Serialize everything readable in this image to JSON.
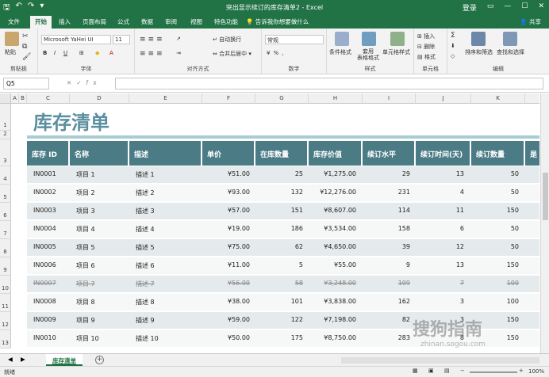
{
  "window": {
    "title": "突出显示续订的库存清单2 - Excel",
    "login": "登录"
  },
  "tabs": [
    "文件",
    "开始",
    "插入",
    "页面布局",
    "公式",
    "数据",
    "审阅",
    "视图",
    "特色功能"
  ],
  "tell_me": "告诉我你想要做什么",
  "share": "共享",
  "ribbon": {
    "paste": "粘贴",
    "clipboard": "剪贴板",
    "font_name": "Microsoft YaHei UI",
    "font_size": "11",
    "font_group": "字体",
    "wrap": "自动换行",
    "merge": "合并后居中",
    "align_group": "对齐方式",
    "num_format": "常规",
    "number_group": "数字",
    "cond_format": "条件格式",
    "table_format": "套用\n表格格式",
    "cell_style": "单元格样式",
    "styles_group": "样式",
    "insert": "插入",
    "delete": "删除",
    "format": "格式",
    "cells_group": "单元格",
    "sort": "排序和筛选",
    "find": "查找和选择",
    "edit_group": "编辑"
  },
  "namebox": "Q5",
  "columns": [
    "A",
    "B",
    "C",
    "D",
    "E",
    "F",
    "G",
    "H",
    "I",
    "J",
    "K"
  ],
  "sheet": {
    "title": "库存清单",
    "headers": [
      "库存 ID",
      "名称",
      "描述",
      "单价",
      "在库数量",
      "库存价值",
      "续订水平",
      "续订时间(天)",
      "续订数量",
      "是"
    ],
    "rows": [
      {
        "id": "IN0001",
        "name": "项目 1",
        "desc": "描述 1",
        "price": "¥51.00",
        "qty": "25",
        "value": "¥1,275.00",
        "level": "29",
        "days": "13",
        "reorder": "50"
      },
      {
        "id": "IN0002",
        "name": "项目 2",
        "desc": "描述 2",
        "price": "¥93.00",
        "qty": "132",
        "value": "¥12,276.00",
        "level": "231",
        "days": "4",
        "reorder": "50"
      },
      {
        "id": "IN0003",
        "name": "项目 3",
        "desc": "描述 3",
        "price": "¥57.00",
        "qty": "151",
        "value": "¥8,607.00",
        "level": "114",
        "days": "11",
        "reorder": "150"
      },
      {
        "id": "IN0004",
        "name": "项目 4",
        "desc": "描述 4",
        "price": "¥19.00",
        "qty": "186",
        "value": "¥3,534.00",
        "level": "158",
        "days": "6",
        "reorder": "50"
      },
      {
        "id": "IN0005",
        "name": "项目 5",
        "desc": "描述 5",
        "price": "¥75.00",
        "qty": "62",
        "value": "¥4,650.00",
        "level": "39",
        "days": "12",
        "reorder": "50"
      },
      {
        "id": "IN0006",
        "name": "项目 6",
        "desc": "描述 6",
        "price": "¥11.00",
        "qty": "5",
        "value": "¥55.00",
        "level": "9",
        "days": "13",
        "reorder": "150"
      },
      {
        "id": "IN0007",
        "name": "项目 7",
        "desc": "描述 7",
        "price": "¥56.00",
        "qty": "58",
        "value": "¥3,248.00",
        "level": "109",
        "days": "7",
        "reorder": "100",
        "strike": true
      },
      {
        "id": "IN0008",
        "name": "项目 8",
        "desc": "描述 8",
        "price": "¥38.00",
        "qty": "101",
        "value": "¥3,838.00",
        "level": "162",
        "days": "3",
        "reorder": "100"
      },
      {
        "id": "IN0009",
        "name": "项目 9",
        "desc": "描述 9",
        "price": "¥59.00",
        "qty": "122",
        "value": "¥7,198.00",
        "level": "82",
        "days": "3",
        "reorder": "150"
      },
      {
        "id": "IN0010",
        "name": "项目 10",
        "desc": "描述 10",
        "price": "¥50.00",
        "qty": "175",
        "value": "¥8,750.00",
        "level": "283",
        "days": "8",
        "reorder": "150"
      }
    ]
  },
  "sheet_tab": "库存清单",
  "status": {
    "ready": "就绪",
    "zoom": "100%"
  },
  "watermark": {
    "main": "搜狗指南",
    "sub": "zhinan.sogou.com"
  },
  "colors": {
    "excel_green": "#217346",
    "header_teal": "#4b7c86",
    "title_teal": "#5b8fa0"
  }
}
